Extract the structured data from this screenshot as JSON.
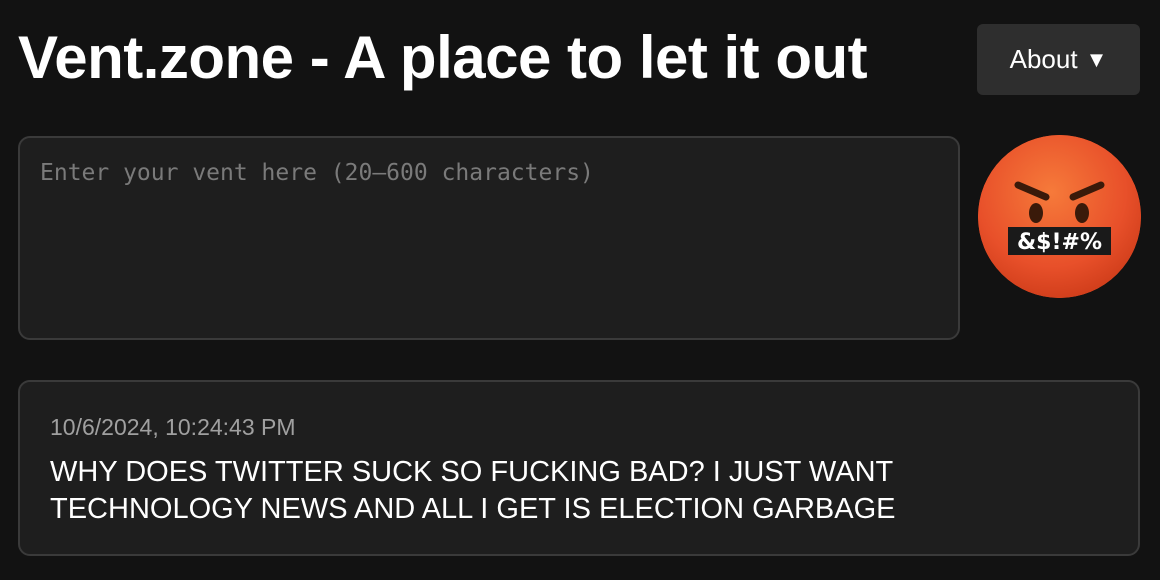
{
  "header": {
    "title": "Vent.zone - A place to let it out",
    "about_label": "About",
    "about_arrow": "▼"
  },
  "composer": {
    "placeholder": "Enter your vent here (20–600 characters)",
    "value": "",
    "submit_icon": "face-with-symbols-on-mouth-icon",
    "emoji_symbols": "&$!#%"
  },
  "feed": {
    "posts": [
      {
        "timestamp": "10/6/2024, 10:24:43 PM",
        "text": "WHY DOES TWITTER SUCK SO FUCKING BAD? I JUST WANT TECHNOLOGY NEWS AND ALL I GET IS ELECTION GARBAGE"
      }
    ]
  },
  "colors": {
    "background": "#121212",
    "card": "#1e1e1e",
    "card_border": "#3a3a3a",
    "button": "#2e2e2e",
    "emoji_circle": "#e84e25"
  }
}
